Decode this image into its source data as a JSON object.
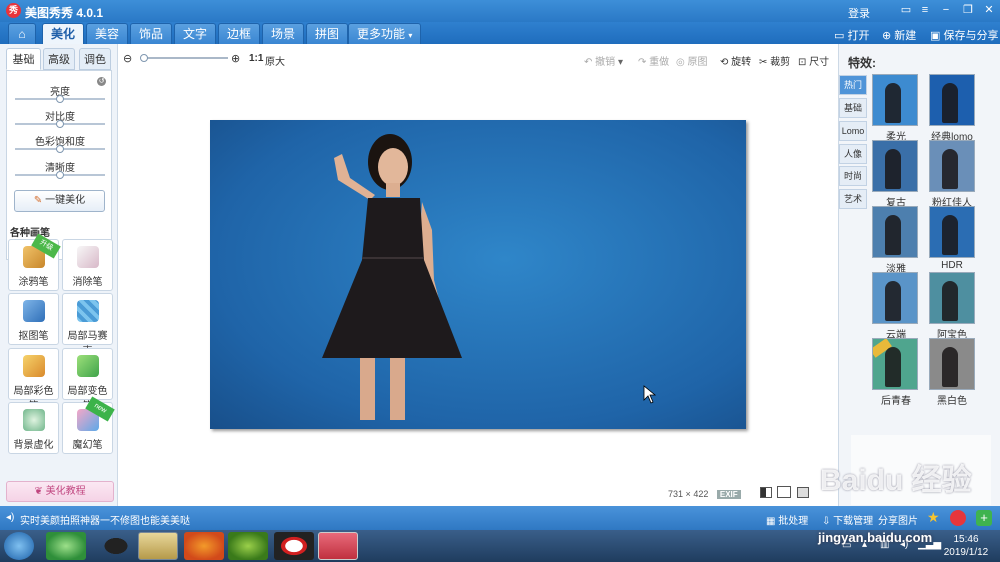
{
  "title_bar": {
    "logo": "秀",
    "title": "美图秀秀 4.0.1",
    "login": "登录"
  },
  "menu": {
    "tabs": [
      "美化",
      "美容",
      "饰品",
      "文字",
      "边框",
      "场景",
      "拼图",
      "更多功能"
    ],
    "actions": {
      "open": "打开",
      "new": "新建",
      "save_share": "保存与分享"
    }
  },
  "left_panel": {
    "subtabs": [
      "基础",
      "高级",
      "调色"
    ],
    "sliders": [
      {
        "label": "亮度",
        "value": 0.5
      },
      {
        "label": "对比度",
        "value": 0.5
      },
      {
        "label": "色彩饱和度",
        "value": 0.5
      },
      {
        "label": "清晰度",
        "value": 0.5
      }
    ],
    "one_key": "一键美化",
    "brushes_heading": "各种画笔",
    "brushes": [
      {
        "label": "涂鸦笔",
        "badge": "升级"
      },
      {
        "label": "消除笔",
        "badge": ""
      },
      {
        "label": "抠图笔",
        "badge": ""
      },
      {
        "label": "局部马赛克",
        "badge": ""
      },
      {
        "label": "局部彩色笔",
        "badge": ""
      },
      {
        "label": "局部变色笔",
        "badge": ""
      },
      {
        "label": "背景虚化",
        "badge": ""
      },
      {
        "label": "魔幻笔",
        "badge": "new"
      }
    ],
    "tutorial": "美化教程"
  },
  "toolbar": {
    "zoom_ratio": "1:1",
    "original_size": "原大",
    "undo": "撤销",
    "redo": "重做",
    "original": "原图",
    "rotate": "旋转",
    "crop": "裁剪",
    "size": "尺寸"
  },
  "canvas": {
    "width": "731",
    "times": "×",
    "height": "422",
    "exif": "EXIF"
  },
  "effects": {
    "heading": "特效:",
    "categories": [
      "热门",
      "基础",
      "Lomo",
      "人像",
      "时尚",
      "艺术"
    ],
    "items": [
      {
        "label": "柔光",
        "tone": "#3d8bd0"
      },
      {
        "label": "经典lomo",
        "tone": "#1d5fae"
      },
      {
        "label": "复古",
        "tone": "#3a6fa8"
      },
      {
        "label": "粉红佳人",
        "tone": "#6a8fb8"
      },
      {
        "label": "淡雅",
        "tone": "#4d7fae"
      },
      {
        "label": "HDR",
        "tone": "#2b6db3"
      },
      {
        "label": "云端",
        "tone": "#5a94c8"
      },
      {
        "label": "阿宝色",
        "tone": "#4e8fa0"
      },
      {
        "label": "后青春",
        "tone": "#4fa58e"
      },
      {
        "label": "黑白色",
        "tone": "#8a8a8a"
      }
    ]
  },
  "status_bar": {
    "message": "实时美颜拍照神器一不修图也能美美哒",
    "batch": "批处理",
    "download": "下载管理",
    "share": "分享图片"
  },
  "taskbar": {
    "time": "15:46",
    "date": "2019/1/12"
  },
  "watermark": {
    "logo": "Baidu 经验",
    "url": "jingyan.baidu.com"
  }
}
